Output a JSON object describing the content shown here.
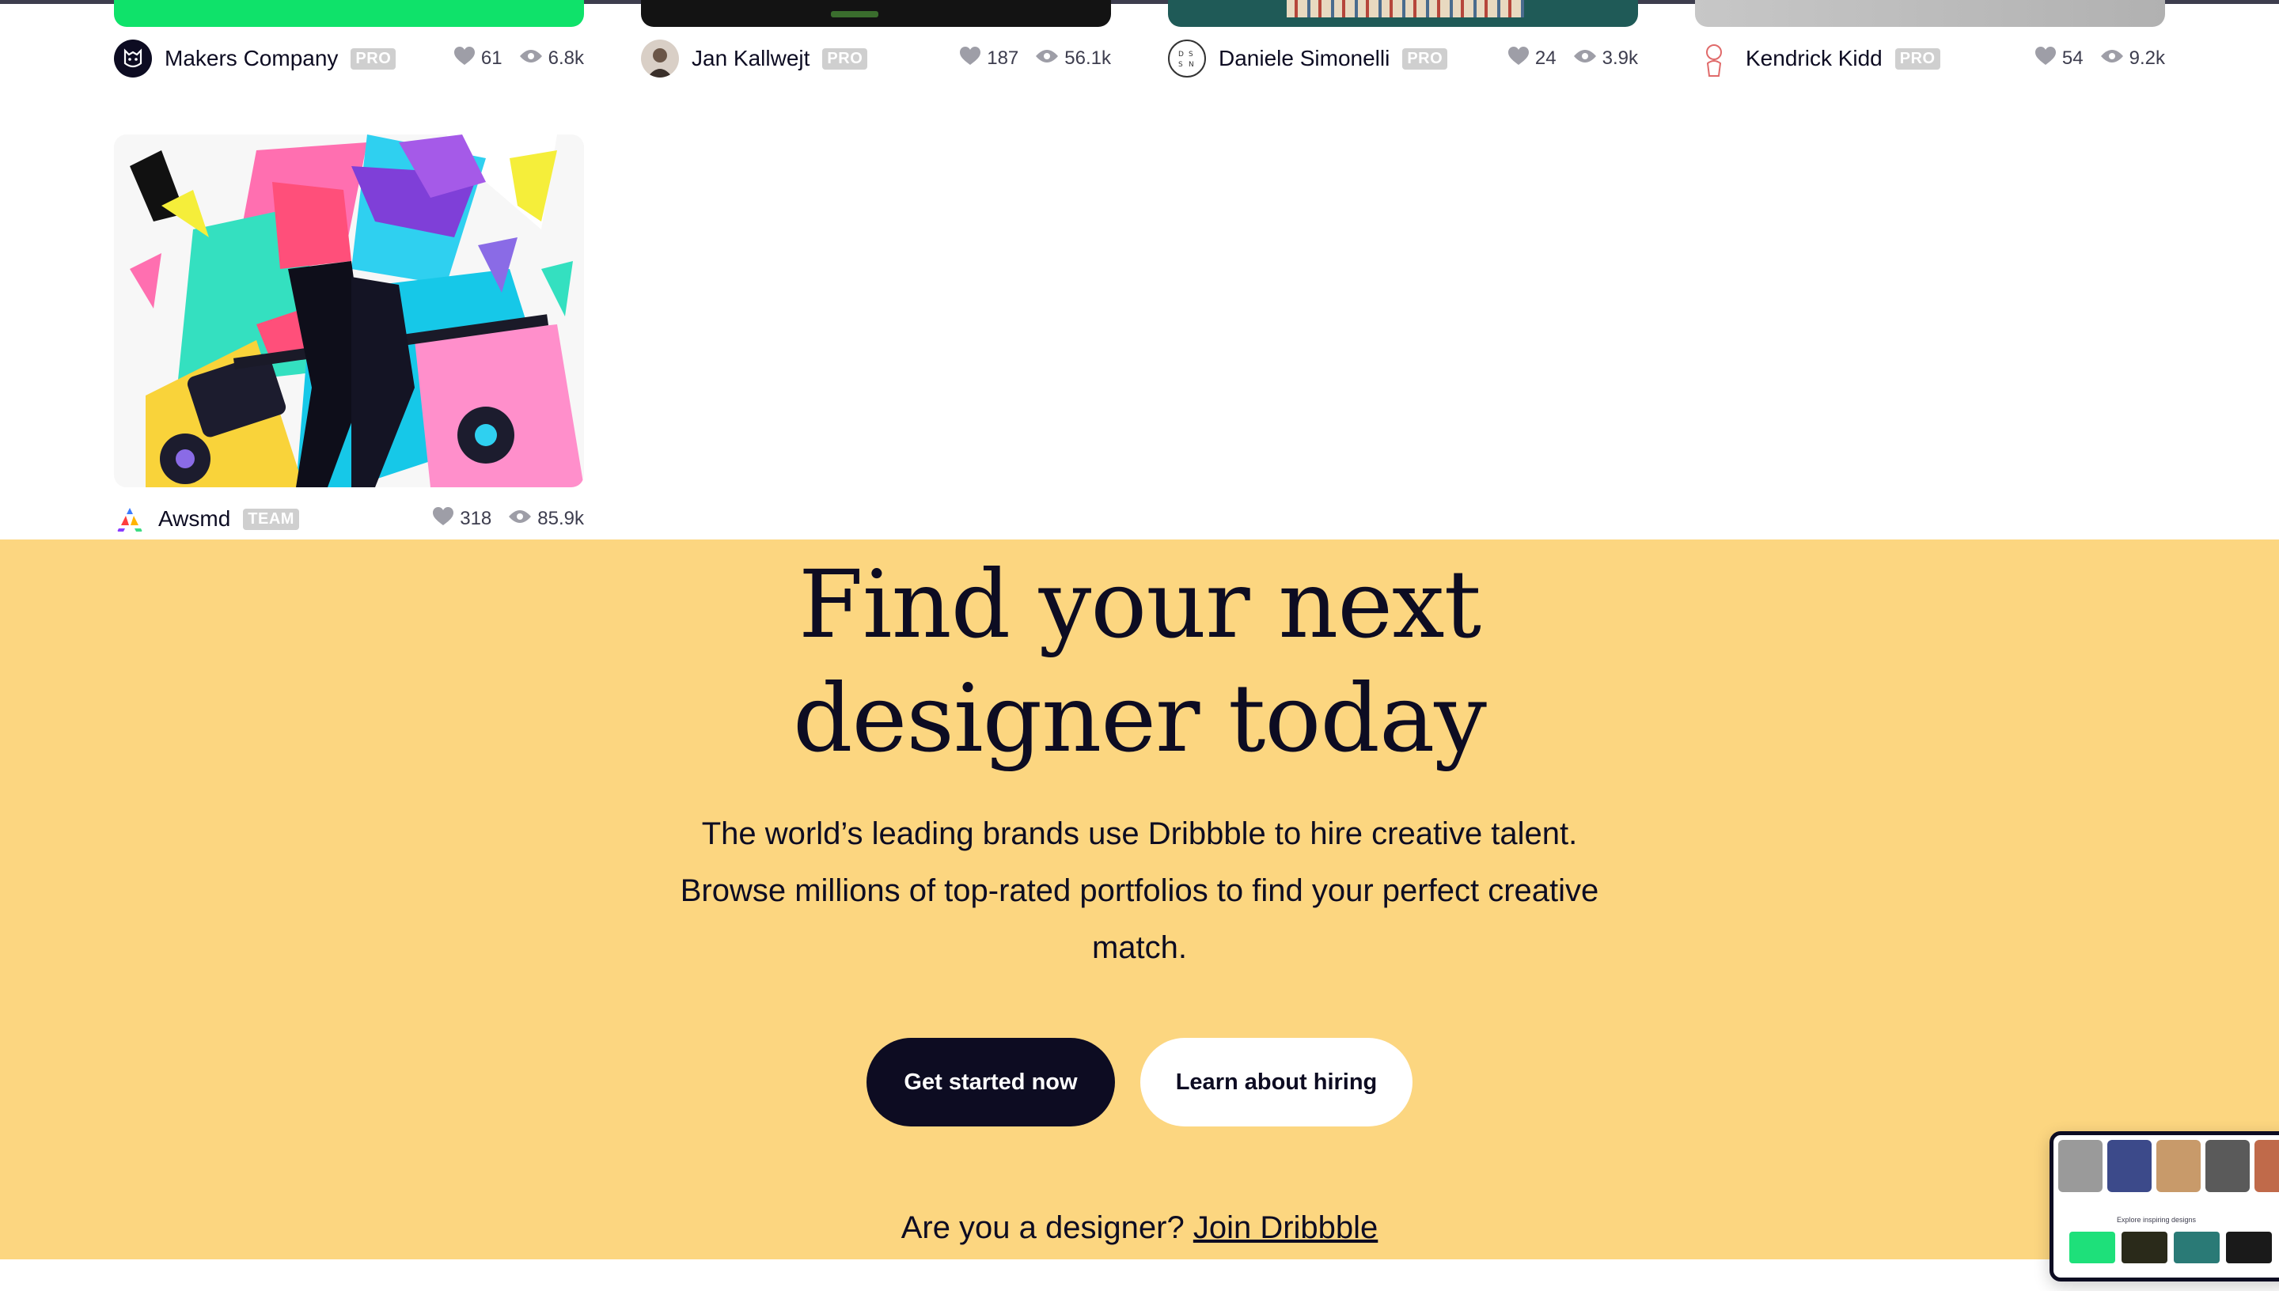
{
  "shots": [
    {
      "author": "Makers Company",
      "badge": "PRO",
      "likes": "61",
      "views": "6.8k"
    },
    {
      "author": "Jan Kallwejt",
      "badge": "PRO",
      "likes": "187",
      "views": "56.1k"
    },
    {
      "author": "Daniele Simonelli",
      "badge": "PRO",
      "likes": "24",
      "views": "3.9k"
    },
    {
      "author": "Kendrick Kidd",
      "badge": "PRO",
      "likes": "54",
      "views": "9.2k"
    },
    {
      "author": "Awsmd",
      "badge": "TEAM",
      "likes": "318",
      "views": "85.9k"
    }
  ],
  "hire": {
    "title_line1": "Find your next",
    "title_line2": "designer today",
    "subtitle": "The world’s leading brands use Dribbble to hire creative talent. Browse millions of top-rated portfolios to find your perfect creative match.",
    "primary_button": "Get started now",
    "secondary_button": "Learn about hiring",
    "designer_prompt": "Are you a designer?",
    "designer_link": "Join Dribbble"
  },
  "preview_card": {
    "caption": "Explore inspiring designs"
  },
  "icons": {
    "like": "heart-icon",
    "views": "eye-icon"
  },
  "colors": {
    "hire_bg": "#fcd680",
    "primary": "#0d0c22",
    "badge": "#cfcfcf"
  }
}
